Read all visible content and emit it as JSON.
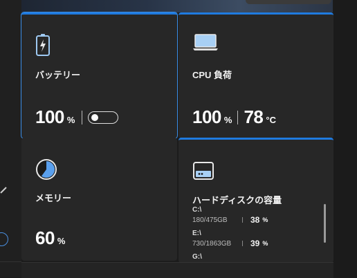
{
  "tiles": {
    "battery": {
      "label": "バッテリー",
      "value": "100",
      "unit": "%"
    },
    "cpu": {
      "label": "CPU 負荷",
      "load": "100",
      "load_unit": "%",
      "temp": "78",
      "temp_unit": "°C"
    },
    "memory": {
      "label": "メモリー",
      "value": "60",
      "unit": "%",
      "fill_fraction": 0.6
    },
    "disk": {
      "label": "ハードディスクの容量",
      "drives": [
        {
          "drive": "C:\\",
          "size": "180/475GB",
          "percent": "38",
          "unit": "%"
        },
        {
          "drive": "E:\\",
          "size": "730/1863GB",
          "percent": "39",
          "unit": "%"
        },
        {
          "drive": "G:\\"
        }
      ]
    }
  },
  "colors": {
    "accent": "#1f7be0",
    "tile_bg": "#272727",
    "background": "#1c1c1c",
    "memory_fill": "#5aa0ee"
  },
  "icons": {
    "battery": "battery-charging-icon",
    "cpu": "laptop-icon",
    "memory": "pie-chart-icon",
    "disk": "hard-disk-icon"
  }
}
